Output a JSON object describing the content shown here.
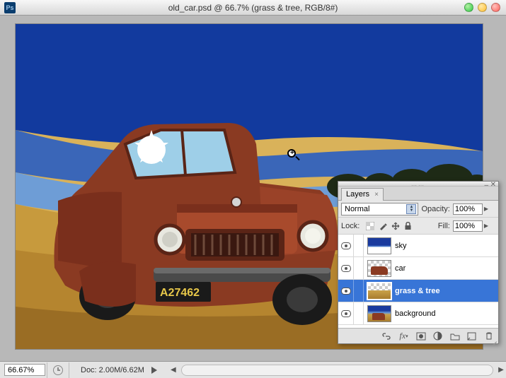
{
  "window": {
    "app_glyph": "Ps",
    "title": "old_car.psd @ 66.7% (grass & tree, RGB/8#)"
  },
  "status": {
    "zoom": "66.67%",
    "doc_info": "Doc: 2.00M/6.62M"
  },
  "layers_panel": {
    "tab_label": "Layers",
    "blend_mode": "Normal",
    "opacity_label": "Opacity:",
    "opacity_value": "100%",
    "lock_label": "Lock:",
    "fill_label": "Fill:",
    "fill_value": "100%",
    "layers": [
      {
        "name": "sky"
      },
      {
        "name": "car"
      },
      {
        "name": "grass & tree"
      },
      {
        "name": "background"
      }
    ]
  }
}
